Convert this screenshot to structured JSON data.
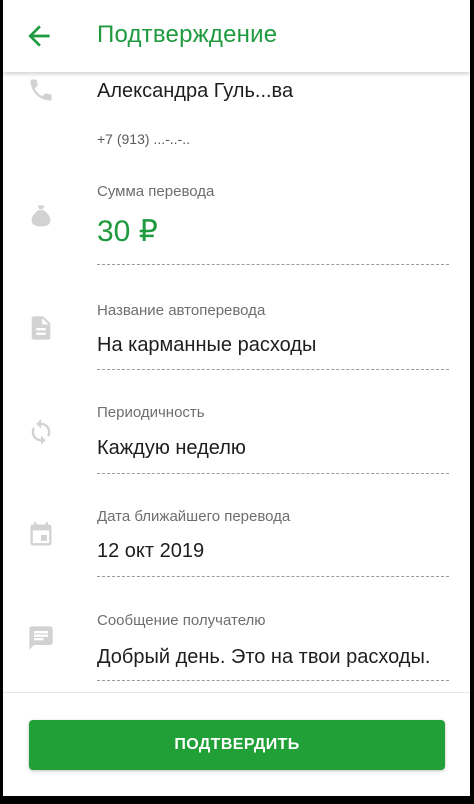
{
  "header": {
    "title": "Подтверждение"
  },
  "recipient": {
    "name": "Александра Гуль...ва",
    "phone": "+7 (913) ...-..-.."
  },
  "fields": [
    {
      "label": "Сумма перевода",
      "value": "30 ₽"
    },
    {
      "label": "Название автоперевода",
      "value": "На карманные расходы"
    },
    {
      "label": "Периодичность",
      "value": "Каждую неделю"
    },
    {
      "label": "Дата ближайшего перевода",
      "value": "12 окт 2019"
    },
    {
      "label": "Сообщение получателю",
      "value": "Добрый день. Это на твои расходы."
    }
  ],
  "footer": {
    "confirm_label": "ПОДТВЕРДИТЬ"
  },
  "colors": {
    "accent": "#21a038",
    "title_green": "#1f9a3f",
    "icon_gray": "#d2d2d2"
  },
  "icons": {
    "back": "arrow-back-icon",
    "phone": "phone-icon",
    "amount": "money-bag-icon",
    "name": "document-icon",
    "period": "repeat-icon",
    "date": "calendar-icon",
    "message": "message-icon"
  }
}
